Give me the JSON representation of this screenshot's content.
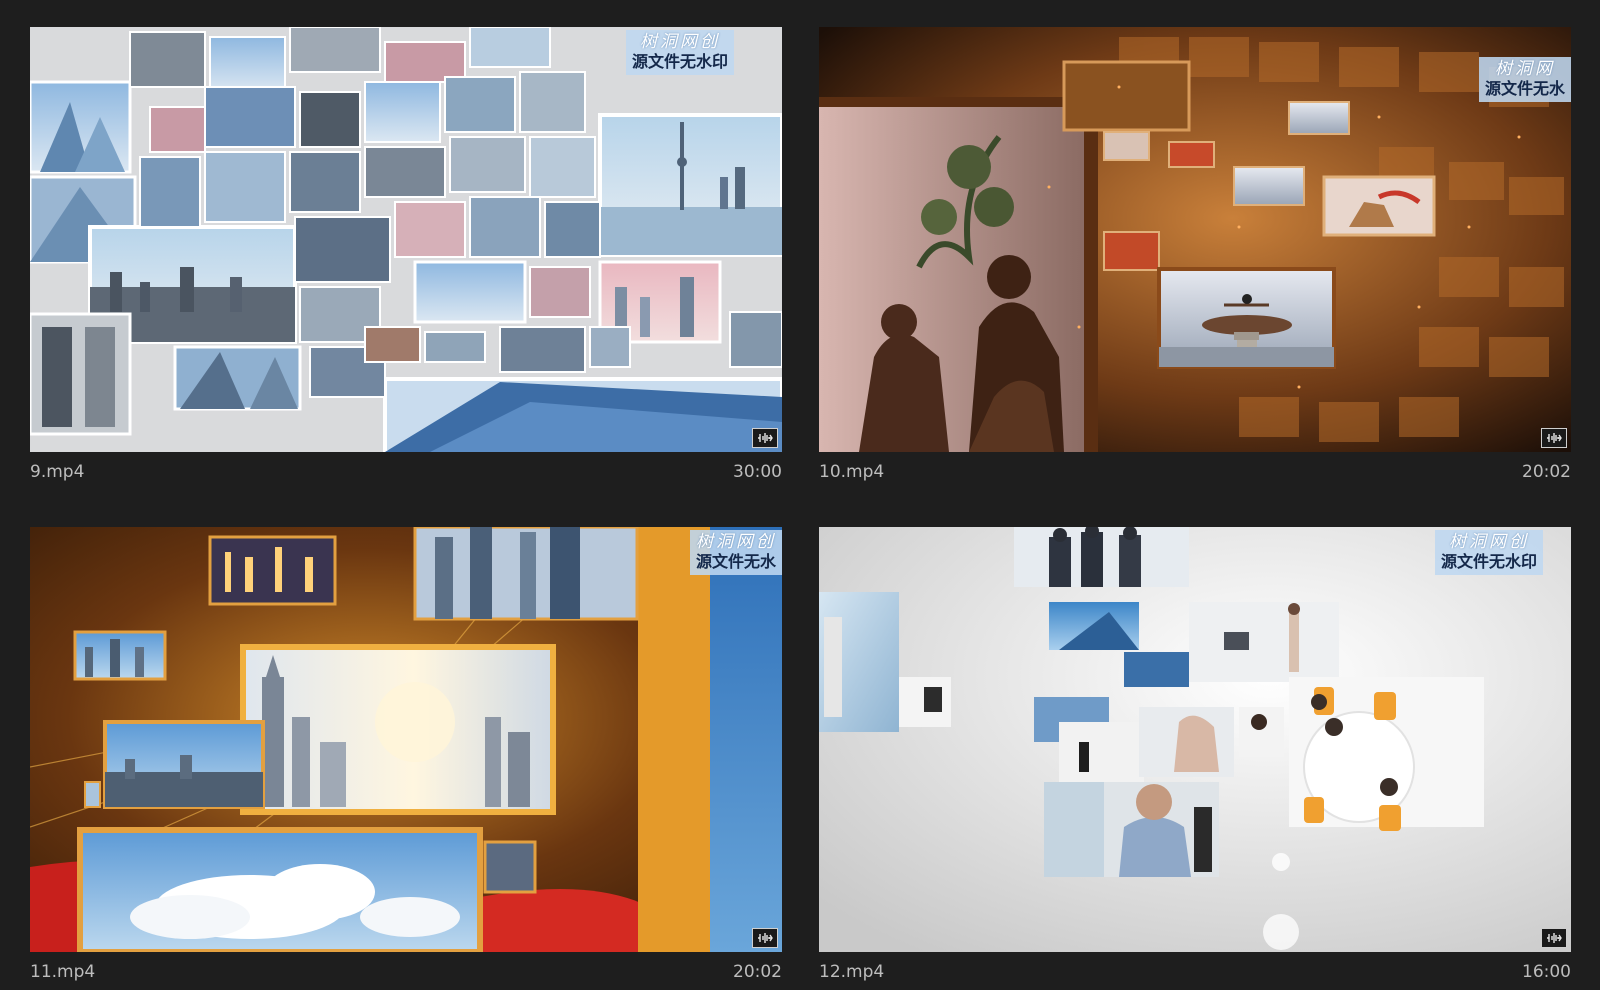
{
  "clips": [
    {
      "name": "9.mp4",
      "duration": "30:00",
      "wm_line1": "树洞网创",
      "wm_line2": "源文件无水印",
      "audio_icon": "audio-waveform-icon"
    },
    {
      "name": "10.mp4",
      "duration": "20:02",
      "wm_line1": "树洞网",
      "wm_line2": "源文件无水",
      "audio_icon": "audio-waveform-icon"
    },
    {
      "name": "11.mp4",
      "duration": "20:02",
      "wm_line1": "树洞网创",
      "wm_line2": "源文件无水",
      "audio_icon": "audio-waveform-icon"
    },
    {
      "name": "12.mp4",
      "duration": "16:00",
      "wm_line1": "树洞网创",
      "wm_line2": "源文件无水印",
      "audio_icon": "audio-waveform-icon"
    }
  ],
  "colors": {
    "background": "#1e1e1e",
    "label_text": "#bdbdbd",
    "watermark_bg": "#bed7f0"
  }
}
